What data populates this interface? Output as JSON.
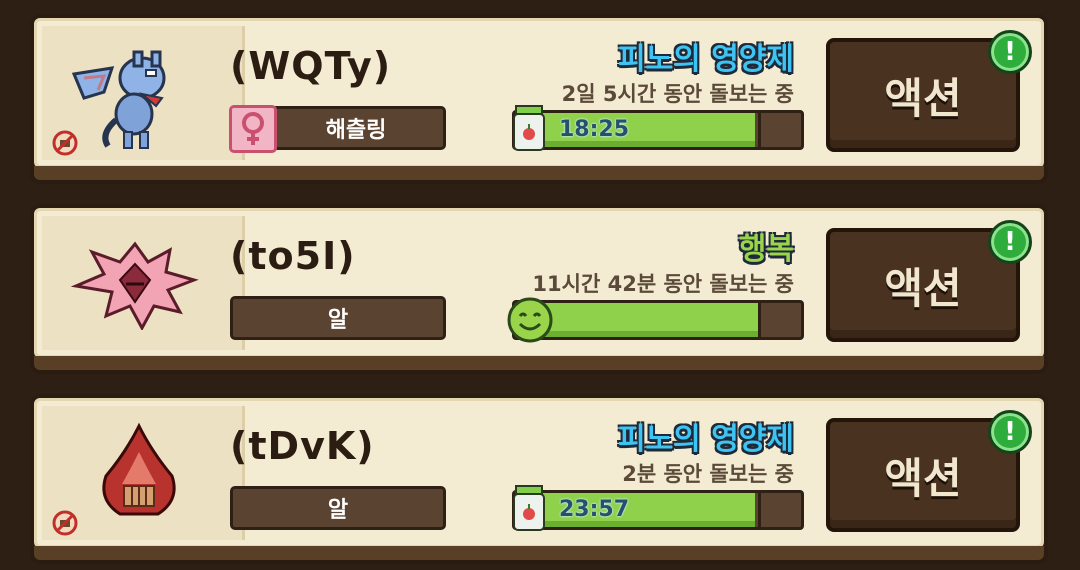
{
  "pets": [
    {
      "name": "(WQTy)",
      "tag": "해츨링",
      "status_title": "피노의 영양제",
      "status_title_color": "#3ec4f2",
      "status_sub": "2일 5시간 동안 돌보는 중",
      "timer": "18:25",
      "progress": 0.84,
      "action_label": "액션",
      "alert": "!"
    },
    {
      "name": "(to5I)",
      "tag": "알",
      "status_title": "행복",
      "status_title_color": "#9ad44a",
      "status_sub": "11시간 42분 동안 돌보는 중",
      "timer": "",
      "progress": 0.86,
      "action_label": "액션",
      "alert": "!"
    },
    {
      "name": "(tDvK)",
      "tag": "알",
      "status_title": "피노의 영양제",
      "status_title_color": "#3ec4f2",
      "status_sub": "2분 동안 돌보는 중",
      "timer": "23:57",
      "progress": 0.84,
      "action_label": "액션",
      "alert": "!"
    }
  ]
}
